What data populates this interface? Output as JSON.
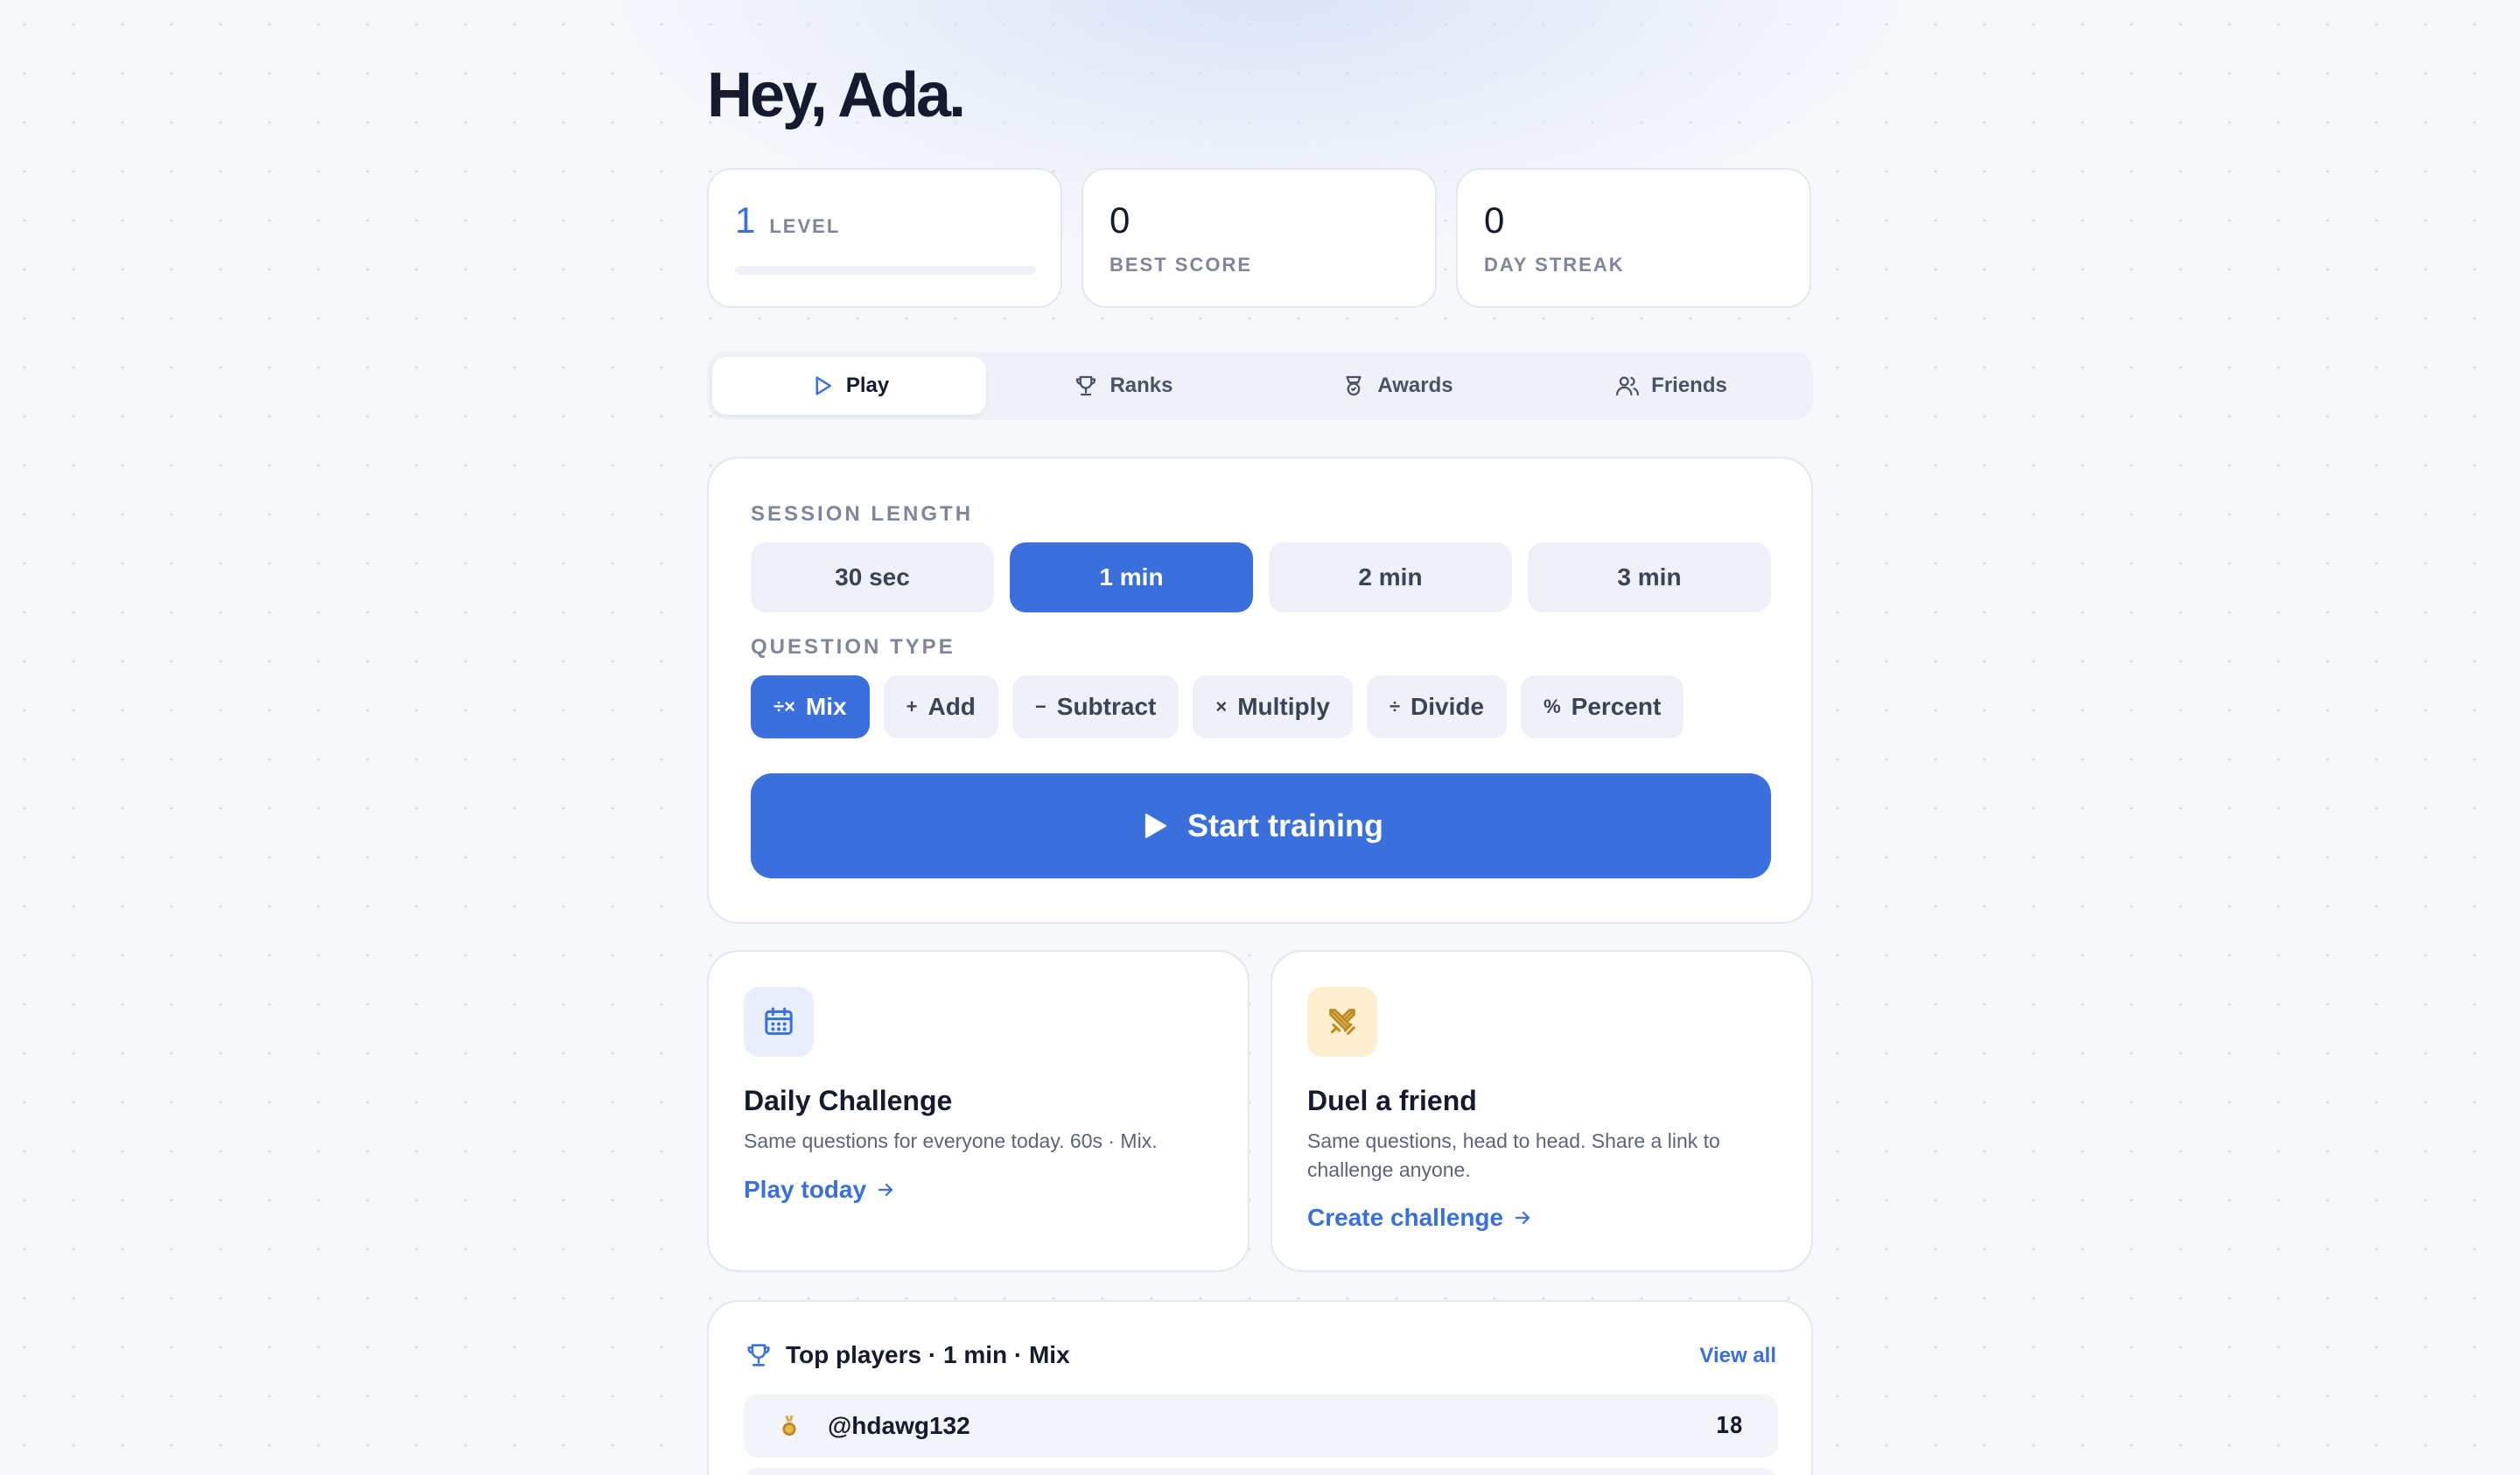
{
  "greeting": "Hey, Ada.",
  "stats": {
    "level": {
      "value": "1",
      "label": "LEVEL",
      "progress": 0
    },
    "best_score": {
      "value": "0",
      "label": "BEST SCORE"
    },
    "day_streak": {
      "value": "0",
      "label": "DAY STREAK"
    }
  },
  "tabs": [
    {
      "label": "Play",
      "icon": "play-icon",
      "active": true
    },
    {
      "label": "Ranks",
      "icon": "trophy-icon",
      "active": false
    },
    {
      "label": "Awards",
      "icon": "award-icon",
      "active": false
    },
    {
      "label": "Friends",
      "icon": "users-icon",
      "active": false
    }
  ],
  "session": {
    "length_label": "SESSION LENGTH",
    "lengths": [
      {
        "label": "30 sec",
        "selected": false
      },
      {
        "label": "1 min",
        "selected": true
      },
      {
        "label": "2 min",
        "selected": false
      },
      {
        "label": "3 min",
        "selected": false
      }
    ],
    "type_label": "QUESTION TYPE",
    "types": [
      {
        "symbol": "÷×",
        "label": "Mix",
        "selected": true
      },
      {
        "symbol": "+",
        "label": "Add",
        "selected": false
      },
      {
        "symbol": "−",
        "label": "Subtract",
        "selected": false
      },
      {
        "symbol": "×",
        "label": "Multiply",
        "selected": false
      },
      {
        "symbol": "÷",
        "label": "Divide",
        "selected": false
      },
      {
        "symbol": "%",
        "label": "Percent",
        "selected": false
      }
    ],
    "start_label": "Start training"
  },
  "daily": {
    "icon": "calendar-icon",
    "title": "Daily Challenge",
    "description": "Same questions for everyone today. 60s · Mix.",
    "link": "Play today"
  },
  "duel": {
    "icon": "swords-icon",
    "title": "Duel a friend",
    "description": "Same questions, head to head. Share a link to challenge anyone.",
    "link": "Create challenge"
  },
  "leaderboard": {
    "title": "Top players · 1 min · Mix",
    "view_all": "View all",
    "rows": [
      {
        "name": "@hdawg132",
        "score": "18",
        "icon": "medal-icon"
      }
    ]
  },
  "colors": {
    "accent": "#3a6fdc",
    "gold": "#c08a1e"
  }
}
